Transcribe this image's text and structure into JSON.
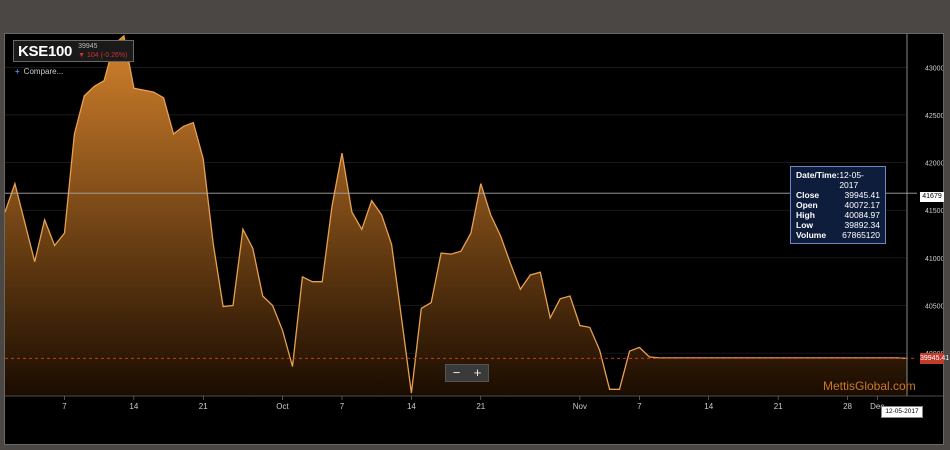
{
  "header": {
    "ticker": "KSE100",
    "price": "39945",
    "change": "104 (-0.26%)",
    "compare_label": "Compare..."
  },
  "zoom": {
    "minus": "−",
    "plus": "+"
  },
  "tooltip": {
    "rows": [
      {
        "k": "Date/Time:",
        "v": "12-05-2017"
      },
      {
        "k": "Close",
        "v": "39945.41"
      },
      {
        "k": "Open",
        "v": "40072.17"
      },
      {
        "k": "High",
        "v": "40084.97"
      },
      {
        "k": "Low",
        "v": "39892.34"
      },
      {
        "k": "Volume",
        "v": "67865120"
      }
    ]
  },
  "crosshair_label": "41679",
  "last_price_label": "39945.41",
  "crosshair_date_label": "12-05-2017",
  "watermark": "MettisGlobal.com",
  "colors": {
    "area_top": "#d4822c",
    "area_bottom": "#1a0c00",
    "line": "#e8a050",
    "grid": "#2a2a2a",
    "axis_text": "#cccccc",
    "last_price": "#c23a2a",
    "tooltip_bg": "#0e1d3c"
  },
  "chart_data": {
    "type": "area",
    "title": "KSE100",
    "xlabel": "",
    "ylabel": "",
    "ylim": [
      39550,
      43350
    ],
    "y_ticks": [
      "40000",
      "40500",
      "41000",
      "41500",
      "42000",
      "42500",
      "43000"
    ],
    "y_tick_values": [
      40000,
      40500,
      41000,
      41500,
      42000,
      42500,
      43000
    ],
    "x_ticks": [
      {
        "label": "7",
        "x": 5
      },
      {
        "label": "14",
        "x": 12
      },
      {
        "label": "21",
        "x": 19
      },
      {
        "label": "Oct",
        "x": 27
      },
      {
        "label": "7",
        "x": 33
      },
      {
        "label": "14",
        "x": 40
      },
      {
        "label": "21",
        "x": 47
      },
      {
        "label": "Nov",
        "x": 57
      },
      {
        "label": "7",
        "x": 63
      },
      {
        "label": "14",
        "x": 70
      },
      {
        "label": "21",
        "x": 77
      },
      {
        "label": "28",
        "x": 84
      },
      {
        "label": "Dec",
        "x": 87
      }
    ],
    "xlim": [
      -1,
      90
    ],
    "x": [
      -1,
      0,
      2,
      3,
      4,
      5,
      6,
      7,
      8,
      9,
      10,
      11,
      12,
      13,
      14,
      15,
      16,
      17,
      18,
      19,
      20,
      21,
      22,
      23,
      24,
      25,
      26,
      27,
      28,
      29,
      30,
      31,
      32,
      33,
      34,
      35,
      36,
      37,
      38,
      39,
      40,
      41,
      42,
      43,
      44,
      45,
      46,
      47,
      48,
      49,
      50,
      51,
      52,
      53,
      54,
      55,
      56,
      57,
      58,
      59,
      60,
      61,
      62,
      63,
      64,
      65,
      66,
      67,
      68,
      69,
      70,
      71,
      72,
      73,
      74,
      75,
      76,
      77,
      78,
      79,
      80,
      81,
      82,
      83,
      84,
      85,
      86,
      87,
      88,
      89,
      90
    ],
    "values": [
      41480,
      41780,
      40960,
      41400,
      41130,
      41260,
      42300,
      42700,
      42800,
      42860,
      43240,
      43330,
      42780,
      42760,
      42740,
      42680,
      42300,
      42380,
      42420,
      42040,
      41150,
      40490,
      40500,
      41300,
      41100,
      40600,
      40500,
      40240,
      39860,
      40800,
      40750,
      40750,
      41550,
      42100,
      41480,
      41300,
      41600,
      41450,
      41140,
      40370,
      39580,
      40470,
      40530,
      41050,
      41040,
      41070,
      41260,
      41780,
      41450,
      41230,
      40940,
      40670,
      40820,
      40850,
      40370,
      40570,
      40600,
      40290,
      40270,
      40030,
      39620,
      39620,
      40020,
      40060,
      39960,
      39950,
      39950,
      39950,
      39950,
      39950,
      39950,
      39950,
      39950,
      39950,
      39950,
      39950,
      39950,
      39950,
      39950,
      39950,
      39950,
      39950,
      39950,
      39950,
      39950,
      39950,
      39950,
      39950,
      39950,
      39950,
      39945
    ]
  }
}
